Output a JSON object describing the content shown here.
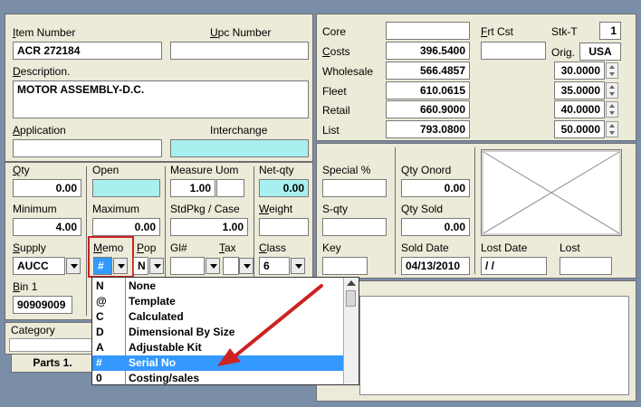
{
  "left_top": {
    "item_number_label": "Item Number",
    "item_number_value": "ACR 272184",
    "upc_label": "Upc  Number",
    "upc_value": "",
    "description_label": "Description.",
    "description_value": "MOTOR ASSEMBLY-D.C.",
    "application_label": "Application",
    "application_value": "",
    "interchange_label": "Interchange",
    "interchange_value": ""
  },
  "pricing": {
    "core_label": "Core",
    "core_value": "",
    "costs_label": "Costs",
    "costs_value": "396.5400",
    "wholesale_label": "Wholesale",
    "wholesale_value": "566.4857",
    "fleet_label": "Fleet",
    "fleet_value": "610.0615",
    "retail_label": "Retail",
    "retail_value": "660.9000",
    "list_label": "List",
    "list_value": "793.0800",
    "frt_cst_label": "Frt Cst",
    "frt_cst_value": "",
    "stkt_label": "Stk-T",
    "stkt_value": "1",
    "orig_label": "Orig.",
    "orig_value": "USA",
    "pct1": "30.0000",
    "pct2": "35.0000",
    "pct3": "40.0000",
    "pct4": "50.0000"
  },
  "qty_block": {
    "qty_label": "Qty",
    "qty_value": "0.00",
    "open_label": "Open",
    "open_value": "",
    "measure_uom_label": "Measure Uom",
    "measure_uom_value": "1.00",
    "measure_uom_unit": "",
    "net_qty_label": "Net-qty",
    "net_qty_value": "0.00",
    "minimum_label": "Minimum",
    "minimum_value": "4.00",
    "maximum_label": "Maximum",
    "maximum_value": "0.00",
    "stdpkg_label": "StdPkg / Case",
    "stdpkg_value": "1.00",
    "weight_label": "Weight",
    "weight_value": "",
    "supply_label": "Supply",
    "supply_value": "AUCC",
    "memo_label": "Memo",
    "memo_value": "#",
    "pop_label": "Pop",
    "pop_value": "N",
    "gl_label": "Gl#",
    "gl_value": "",
    "tax_label": "Tax",
    "tax_value": "",
    "class_label": "Class",
    "class_value": "6",
    "bin1_label": "Bin 1",
    "bin1_value": "90909009",
    "category_label": "Category",
    "tab_parts": "Parts 1."
  },
  "sales": {
    "special_label": "Special %",
    "special_value": "",
    "qty_onord_label": "Qty Onord",
    "qty_onord_value": "0.00",
    "sqty_label": "S-qty",
    "sqty_value": "",
    "qty_sold_label": "Qty Sold",
    "qty_sold_value": "0.00",
    "key_label": "Key",
    "key_value": "",
    "sold_date_label": "Sold Date",
    "sold_date_value": "04/13/2010",
    "lost_date_label": "Lost Date",
    "lost_date_value": " / /",
    "lost_label": "Lost",
    "lost_value": ""
  },
  "memo_dropdown": {
    "options": [
      {
        "code": "N",
        "label": "None"
      },
      {
        "code": "@",
        "label": "Template"
      },
      {
        "code": "C",
        "label": "Calculated"
      },
      {
        "code": "D",
        "label": "Dimensional By Size"
      },
      {
        "code": "A",
        "label": "Adjustable Kit"
      },
      {
        "code": "#",
        "label": "Serial No"
      },
      {
        "code": "0",
        "label": "Costing/sales"
      }
    ],
    "selected_index": 5
  },
  "colors": {
    "panel_bg": "#ecead8",
    "highlight_cyan": "#a8f0f0",
    "selection_blue": "#3399ff",
    "annotation_red": "#cc2222"
  }
}
